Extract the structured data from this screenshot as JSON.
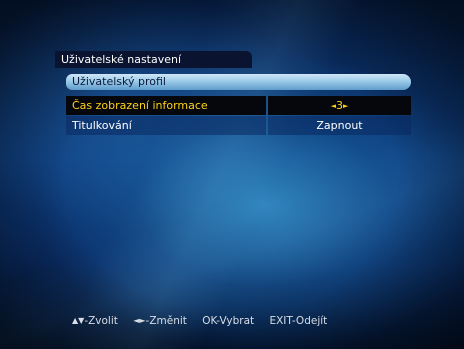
{
  "menu": {
    "title": "Uživatelské nastavení",
    "section": "Uživatelský profil",
    "rows": [
      {
        "label": "Čas zobrazení informace",
        "value": "3",
        "left_arrow": "◄",
        "right_arrow": "►"
      },
      {
        "label": "Titulkování",
        "value": "Zapnout"
      }
    ]
  },
  "footer": {
    "nav": {
      "glyph": "▲▼",
      "text": "-Zvolit"
    },
    "change": {
      "glyph": "◄►",
      "text": "-Změnit"
    },
    "ok": {
      "text": "OK-Vybrat"
    },
    "exit": {
      "text": "EXIT-Odejít"
    }
  },
  "colors": {
    "selected_text": "#ffd21a",
    "header_bg": "#9ccbe9",
    "background": "#0d3c7d"
  }
}
